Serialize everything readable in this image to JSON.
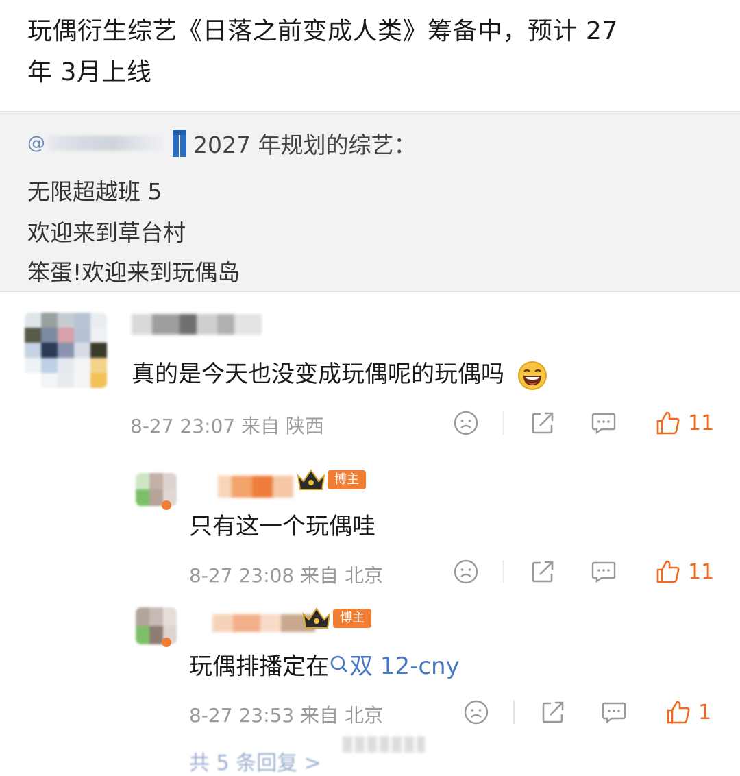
{
  "post": {
    "title_line1": "玩偶衍生综艺《日落之前变成人类》筹备中，预计 27",
    "title_line2": "年 3月上线"
  },
  "quote": {
    "head_text": "2027 年规划的综艺：",
    "lines": [
      "无限超越班 5",
      "欢迎来到草台村",
      "笨蛋!欢迎来到玩偶岛"
    ]
  },
  "comments": [
    {
      "text": "真的是今天也没变成玩偶呢的玩偶吗",
      "meta": "8-27 23:07  来自 陕西",
      "likes": "11"
    }
  ],
  "replies": [
    {
      "badge": "博主",
      "text": "只有这一个玩偶哇",
      "meta": "8-27 23:08  来自 北京",
      "likes": "11"
    },
    {
      "badge": "博主",
      "text_prefix": "玩偶排播定在",
      "search_text": "双 12-cny",
      "meta": "8-27 23:53  来自 北京",
      "likes": "1"
    }
  ],
  "footer": {
    "text": "共 5 条回复 >"
  },
  "icons": {
    "dislike": "frown-face-icon",
    "share": "share-icon",
    "comment": "comment-bubble-icon",
    "like": "thumbs-up-icon",
    "search": "search-icon"
  },
  "colors": {
    "accent": "#f06a1e",
    "link": "#4a78c2",
    "badge": "#f07f35"
  }
}
